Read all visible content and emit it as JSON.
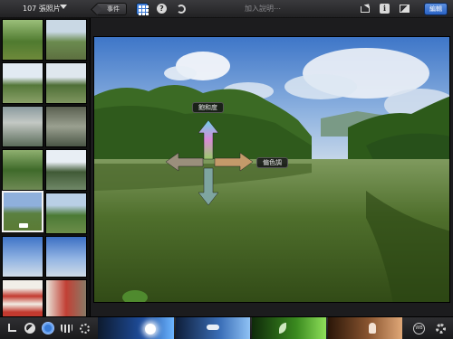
{
  "topbar": {
    "album_title": "107 張照片",
    "back_label": "事件",
    "add_caption": "加入說明⋯",
    "edit_label": "編輯"
  },
  "overlay": {
    "saturation_label": "飽和度",
    "tint_label": "偏色調"
  },
  "colors": {
    "accent_blue": "#3d7bd6",
    "sky": "#5d8fcf",
    "water": "#3d5a24"
  },
  "icons": {
    "grid": "grid-icon",
    "help": "help-icon",
    "undo": "undo-icon",
    "share": "share-icon",
    "info": "info-icon",
    "compare": "compare-icon",
    "crop": "crop-icon",
    "exposure": "exposure-icon",
    "color": "color-icon",
    "brushes": "brush-icon",
    "effects": "effects-icon",
    "white_balance": "white-balance-icon",
    "settings": "gear-icon"
  },
  "bottom_tools": {
    "swatches": [
      "blue-sky-swatch",
      "cloud-swatch",
      "foliage-swatch",
      "skin-tone-swatch"
    ]
  }
}
